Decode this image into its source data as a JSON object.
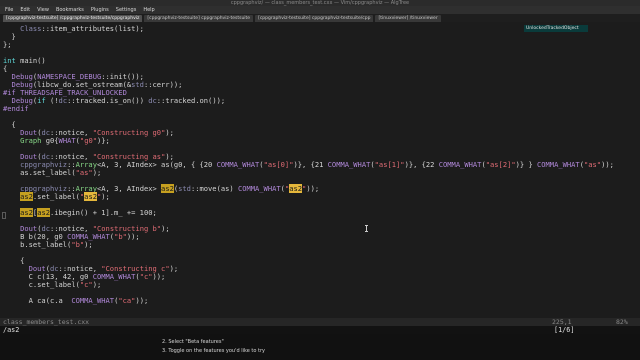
{
  "window": {
    "title": "cppgraphviz/ — class_members_test.cxx — Vim/cppgraphviz — AlgTree"
  },
  "menu": [
    "File",
    "Edit",
    "View",
    "Bookmarks",
    "Plugins",
    "Settings",
    "Help"
  ],
  "tabs": [
    {
      "label": "[cppgraphviz-testsuite] /cppgraphviz-testsuite/cppgraphviz"
    },
    {
      "label": "[cppgraphviz-testsuite] cppgraphviz-testsuite"
    },
    {
      "label": "[cppgraphviz-testsuite] cppgraphviz-testsuite/cpp"
    },
    {
      "label": "[tinuxviewer] /tinuxviewer"
    }
  ],
  "popup": {
    "label": "UnlockedTrackedObject"
  },
  "code_lines": [
    {
      "text": "    Class::item_attributes(list);"
    },
    {
      "text": "  }"
    },
    {
      "text": "};"
    },
    {
      "text": ""
    },
    {
      "text": "int main()"
    },
    {
      "text": "{"
    },
    {
      "text": "  Debug(NAMESPACE_DEBUG::init());"
    },
    {
      "text": "  Debug(libcw_do.set_ostream(&std::cerr));"
    },
    {
      "text": "#if THREADSAFE_TRACK_UNLOCKED"
    },
    {
      "text": "  Debug(if (!dc::tracked.is_on()) dc::tracked.on());"
    },
    {
      "text": "#endif"
    },
    {
      "text": ""
    },
    {
      "text": "  {"
    },
    {
      "text": "    Dout(dc::notice, \"Constructing g0\");"
    },
    {
      "text": "    Graph g0{WHAT(\"g0\")};"
    },
    {
      "text": ""
    },
    {
      "text": "    Dout(dc::notice, \"Constructing as\");"
    },
    {
      "text": "    cppgraphviz::Array<A, 3, AIndex> as(g0, { {20 COMMA_WHAT(\"as[0]\")}, {21 COMMA_WHAT(\"as[1]\")}, {22 COMMA_WHAT(\"as[2]\")} } COMMA_WHAT(\"as\"));"
    },
    {
      "text": "    as.set_label(\"as\");"
    },
    {
      "text": ""
    },
    {
      "text": "    cppgraphviz::Array<A, 3, AIndex> as2(std::move(as) COMMA_WHAT(\"as2\"));"
    },
    {
      "text": "    as2.set_label(\"as2\");"
    },
    {
      "text": ""
    },
    {
      "text": "    as2[as2.ibegin() + 1].m_ += 100;"
    },
    {
      "text": ""
    },
    {
      "text": "    Dout(dc::notice, \"Constructing b\");"
    },
    {
      "text": "    B b(20, g0 COMMA_WHAT(\"b\"));"
    },
    {
      "text": "    b.set_label(\"b\");"
    },
    {
      "text": ""
    },
    {
      "text": "    {"
    },
    {
      "text": "      Dout(dc::notice, \"Constructing c\");"
    },
    {
      "text": "      C c(13, 42, g0 COMMA_WHAT(\"c\"));"
    },
    {
      "text": "      c.set_label(\"c\");"
    },
    {
      "text": ""
    },
    {
      "text": "      A ca(c.a  COMMA_WHAT(\"ca\"));"
    }
  ],
  "status": {
    "file": "class_members_test.cxx",
    "position": "225,1",
    "percent": "82%"
  },
  "cmdline": {
    "text": "/as2",
    "count": "[1/6]"
  },
  "hints": [
    "2. Select \"Beta features\"",
    "3. Toggle on the features you'd like to try"
  ]
}
